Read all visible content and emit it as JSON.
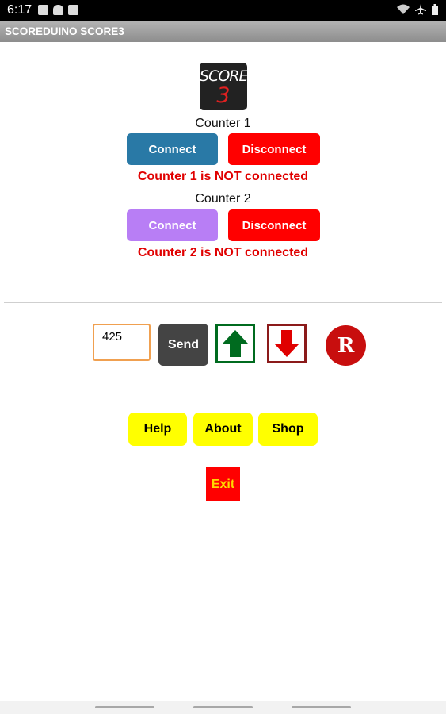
{
  "status_bar": {
    "time": "6:17",
    "left_icons": [
      "image-icon",
      "android-icon",
      "checkbox-icon"
    ],
    "right_icons": [
      "wifi-icon",
      "airplane-icon",
      "battery-icon"
    ]
  },
  "app_bar": {
    "title": "SCOREDUINO SCORE3"
  },
  "logo": {
    "text": "SCORE",
    "number": "3"
  },
  "counter1": {
    "label": "Counter 1",
    "connect_label": "Connect",
    "disconnect_label": "Disconnect",
    "status": "Counter 1 is NOT connected",
    "connect_color": "#2979a6"
  },
  "counter2": {
    "label": "Counter 2",
    "connect_label": "Connect",
    "disconnect_label": "Disconnect",
    "status": "Counter 2 is NOT connected",
    "connect_color": "#b87ef5"
  },
  "controls": {
    "value": "425",
    "send_label": "Send",
    "up_icon": "arrow-up-icon",
    "down_icon": "arrow-down-icon",
    "reset_label": "R"
  },
  "menu": {
    "help_label": "Help",
    "about_label": "About",
    "shop_label": "Shop",
    "exit_label": "Exit"
  },
  "colors": {
    "disconnect": "#ff0000",
    "status_text": "#e00000",
    "up_arrow": "#006b1f",
    "down_arrow": "#e00000",
    "menu_button": "#ffff00",
    "exit_button": "#ff0000",
    "exit_text": "#ffd700"
  }
}
